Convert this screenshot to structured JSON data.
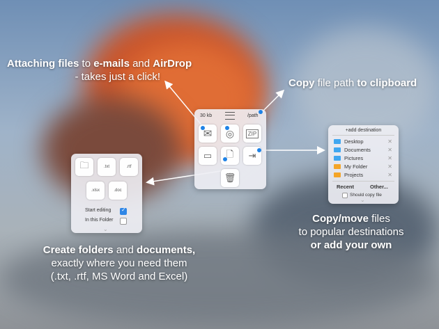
{
  "captions": {
    "attach": {
      "line1_a": "Attaching files",
      "line1_b": " to ",
      "line1_c": "e-mails",
      "line1_d": " and ",
      "line1_e": "AirDrop",
      "line2": "- takes just a click!"
    },
    "copy_path": {
      "a": "Copy",
      "b": " file path ",
      "c": "to clipboard"
    },
    "create": {
      "a": "Create folders",
      "b": " and ",
      "c": "documents,",
      "line2": "exactly where you need them",
      "line3": "(.txt, .rtf, MS Word and Excel)"
    },
    "copy_move": {
      "a": "Copy/move",
      "b": " files",
      "line2": "to popular destinations",
      "line3": "or add your own"
    }
  },
  "main_panel": {
    "size": "30 kb",
    "path": "/path"
  },
  "create_panel": {
    "tiles": [
      ".txt",
      ".rtf",
      ".xlsx",
      ".doc"
    ],
    "start_editing": "Start editing",
    "in_this_folder": "In this Folder"
  },
  "dest_panel": {
    "add_label": "+add destination",
    "destinations": [
      {
        "name": "Desktop",
        "color": "#3fa6f0"
      },
      {
        "name": "Documents",
        "color": "#3fa6f0"
      },
      {
        "name": "Pictures",
        "color": "#3fa6f0"
      },
      {
        "name": "My Folder",
        "color": "#f4a528"
      },
      {
        "name": "Projects",
        "color": "#f4a528"
      }
    ],
    "recent": "Recent",
    "other": "Other...",
    "should_copy": "Should copy file"
  }
}
